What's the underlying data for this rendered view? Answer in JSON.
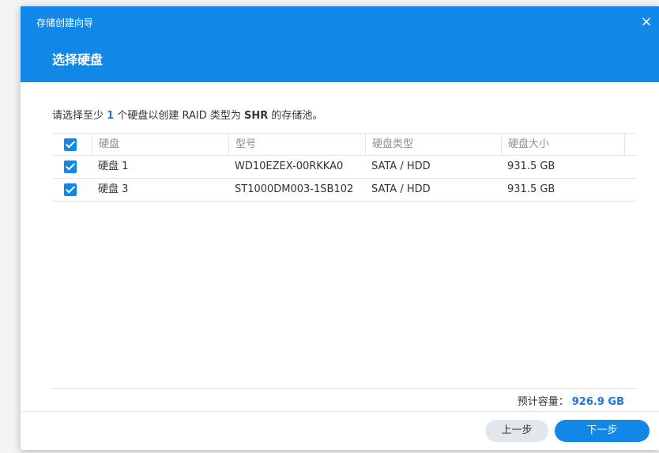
{
  "window": {
    "title": "存储创建向导",
    "close": "×"
  },
  "step": {
    "title": "选择硬盘"
  },
  "instruction": {
    "part1": "请选择至少",
    "count": "1",
    "part2": "个硬盘以创建 RAID 类型为",
    "raid_type": "SHR",
    "part3": "的存储池。"
  },
  "table": {
    "headers": {
      "disk": "硬盘",
      "model": "型号",
      "type": "硬盘类型",
      "size": "硬盘大小"
    },
    "rows": [
      {
        "disk": "硬盘 1",
        "model": "WD10EZEX-00RKKA0",
        "type": "SATA / HDD",
        "size": "931.5 GB",
        "checked": true
      },
      {
        "disk": "硬盘 3",
        "model": "ST1000DM003-1SB102",
        "type": "SATA / HDD",
        "size": "931.5 GB",
        "checked": true
      }
    ]
  },
  "capacity": {
    "label": "预计容量：",
    "value": "926.9 GB"
  },
  "buttons": {
    "prev": "上一步",
    "next": "下一步"
  },
  "colors": {
    "header_bg": "#1187e8",
    "accent_text": "#1e74d2",
    "checkbox": "#1187e8",
    "next_button": "#1187e8",
    "prev_button": "#e2e7ee"
  },
  "icons": {
    "close": "close-icon",
    "checkbox": "checkbox-checked-icon"
  }
}
